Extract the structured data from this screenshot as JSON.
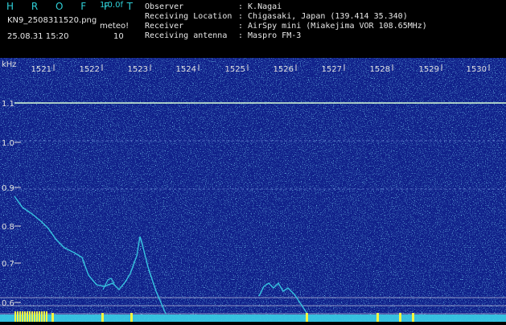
{
  "header": {
    "logo": "H R O F F T",
    "version": "1.0.0f",
    "filename": "KN9_2508311520.png",
    "datetime": "25.08.31 15:20",
    "meteor_label": "meteo!",
    "meteor_count": "10"
  },
  "info": [
    {
      "label": "Observer",
      "value": ": K.Nagai"
    },
    {
      "label": "Receiving Location",
      "value": ": Chigasaki, Japan (139.414 35.340)"
    },
    {
      "label": "Receiver",
      "value": ": AirSpy mini (Miakejima VOR 108.65MHz)"
    },
    {
      "label": "Receiving antenna",
      "value": ": Maspro FM-3"
    }
  ],
  "plot": {
    "y_unit": "kHz",
    "y_ticks": [
      "1.1",
      "1.0",
      "0.9",
      "0.8",
      "0.7",
      "0.6"
    ],
    "x_ticks": [
      "1521",
      "1522",
      "1523",
      "1524",
      "1525",
      "1526",
      "1527",
      "1528",
      "1529",
      "1530"
    ],
    "colors": {
      "background": "#10208a",
      "noise_cyan": "#37c4e0",
      "carrier": "#d8ffd8",
      "grid": "#e0e0e0"
    }
  }
}
